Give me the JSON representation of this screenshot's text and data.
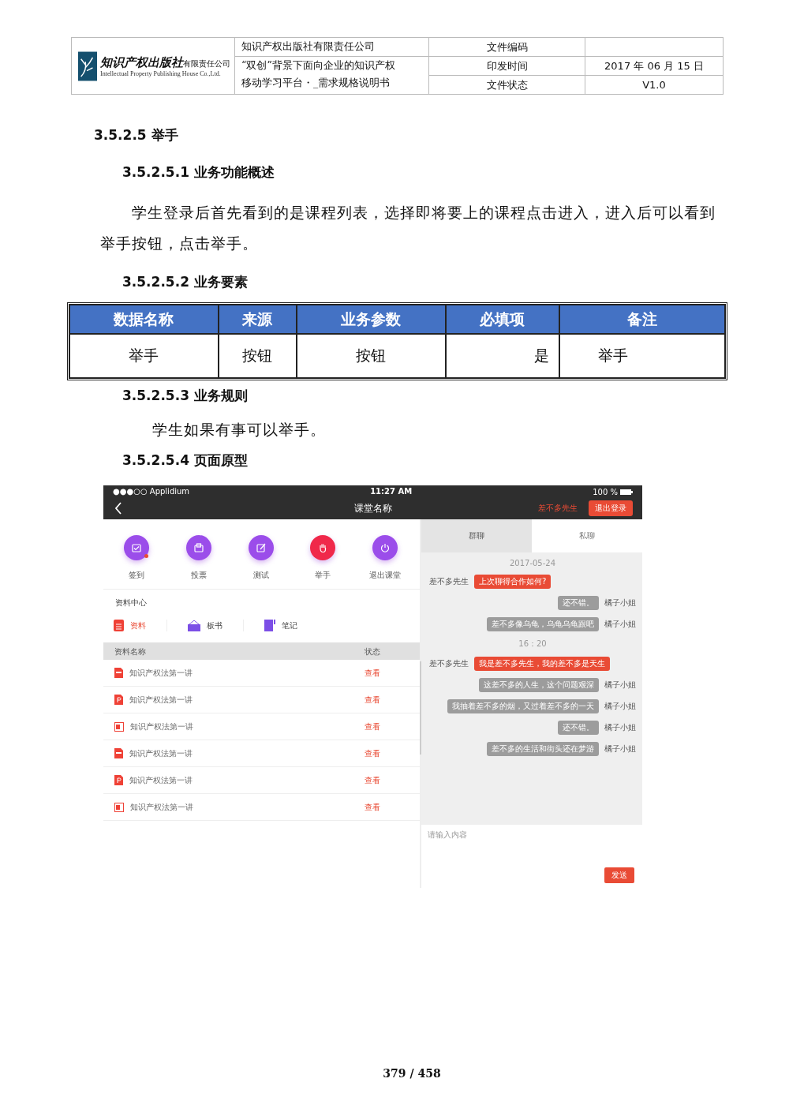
{
  "header": {
    "logo_text": "知识产权出版社",
    "logo_suffix": "有限责任公司",
    "logo_english": "Intellectual Property Publishing House Co.,Ltd.",
    "company": "知识产权出版社有限责任公司",
    "title_lines": [
      "“双创”背景下面向企业的知识产权",
      "移动学习平台・_需求规格说明书"
    ],
    "fields": [
      {
        "label": "文件编码"
      },
      {
        "label": "印发时间",
        "value": "2017 年 06 月 15 日"
      },
      {
        "label": "文件状态",
        "value": "V1.0"
      }
    ]
  },
  "section_heading": "3.5.2.5 举手",
  "overview": {
    "heading": "3.5.2.5.1 业务功能概述",
    "text": "学生登录后首先看到的是课程列表，选择即将要上的课程点击进入，进入后可以看到举手按钮，点击举手。"
  },
  "elements": {
    "heading": "3.5.2.5.2 业务要素",
    "columns": [
      "数据名称",
      "来源",
      "业务参数",
      "必填项",
      "备注"
    ],
    "rows": [
      [
        "举手",
        "按钮",
        "按钮",
        "是",
        "举手"
      ]
    ]
  },
  "rules": {
    "heading": "3.5.2.5.3 业务规则",
    "text": "学生如果有事可以举手。"
  },
  "prototype": {
    "heading": "3.5.2.5.4 页面原型",
    "status_bar": {
      "carrier": "●●●○○ Applidium",
      "time": "11:27 AM",
      "battery": "100 %"
    },
    "nav": {
      "title": "课堂名称",
      "user": "差不多先生",
      "logout": "退出登录"
    },
    "actions": [
      {
        "label": "签到",
        "kind": "checkin",
        "color": "#9b4dea",
        "notification": true
      },
      {
        "label": "投票",
        "kind": "vote",
        "color": "#9b4dea",
        "notification": false
      },
      {
        "label": "测试",
        "kind": "test",
        "color": "#9b4dea",
        "notification": false
      },
      {
        "label": "举手",
        "kind": "hand",
        "color": "#f0284a",
        "notification": false
      },
      {
        "label": "退出课堂",
        "kind": "exit",
        "color": "#9b4dea",
        "notification": false
      }
    ],
    "resources": {
      "title": "资料中心",
      "tabs": [
        {
          "label": "资料",
          "kind": "document",
          "selected": true
        },
        {
          "label": "板书",
          "kind": "board",
          "selected": false
        },
        {
          "label": "笔记",
          "kind": "notebook",
          "selected": false
        }
      ],
      "columns": [
        "资料名称",
        "状态"
      ],
      "rows": [
        {
          "name": "知识产权法第一讲",
          "kind": "txt",
          "action": "查看"
        },
        {
          "name": "知识产权法第一讲",
          "kind": "pdf",
          "action": "查看"
        },
        {
          "name": "知识产权法第一讲",
          "kind": "slides",
          "action": "查看"
        },
        {
          "name": "知识产权法第一讲",
          "kind": "txt",
          "action": "查看"
        },
        {
          "name": "知识产权法第一讲",
          "kind": "pdf",
          "action": "查看"
        },
        {
          "name": "知识产权法第一讲",
          "kind": "slides",
          "action": "查看"
        }
      ]
    },
    "chat": {
      "tabs": [
        {
          "label": "群聊",
          "selected": true
        },
        {
          "label": "私聊",
          "selected": false
        }
      ],
      "messages": [
        {
          "kind": "time",
          "text": "2017-05-24"
        },
        {
          "kind": "incoming",
          "sender": "差不多先生",
          "text": "上次聊得合作如何?"
        },
        {
          "kind": "outgoing",
          "sender": "橘子小姐",
          "text": "还不错。"
        },
        {
          "kind": "outgoing",
          "sender": "橘子小姐",
          "text": "差不多像乌龟，乌龟乌龟跟吧"
        },
        {
          "kind": "time",
          "text": "16：20"
        },
        {
          "kind": "incoming",
          "sender": "差不多先生",
          "text": "我是差不多先生，我的差不多是天生"
        },
        {
          "kind": "outgoing",
          "sender": "橘子小姐",
          "text": "这差不多的人生，这个问题艰深"
        },
        {
          "kind": "outgoing",
          "sender": "橘子小姐",
          "text": "我抽着差不多的烟，又过着差不多的一天"
        },
        {
          "kind": "outgoing",
          "sender": "橘子小姐",
          "text": "还不错。"
        },
        {
          "kind": "outgoing",
          "sender": "橘子小姐",
          "text": "差不多的生活和街头还在梦游"
        }
      ],
      "placeholder": "请输入内容",
      "send": "发送"
    }
  },
  "page_number": "379 / 458"
}
